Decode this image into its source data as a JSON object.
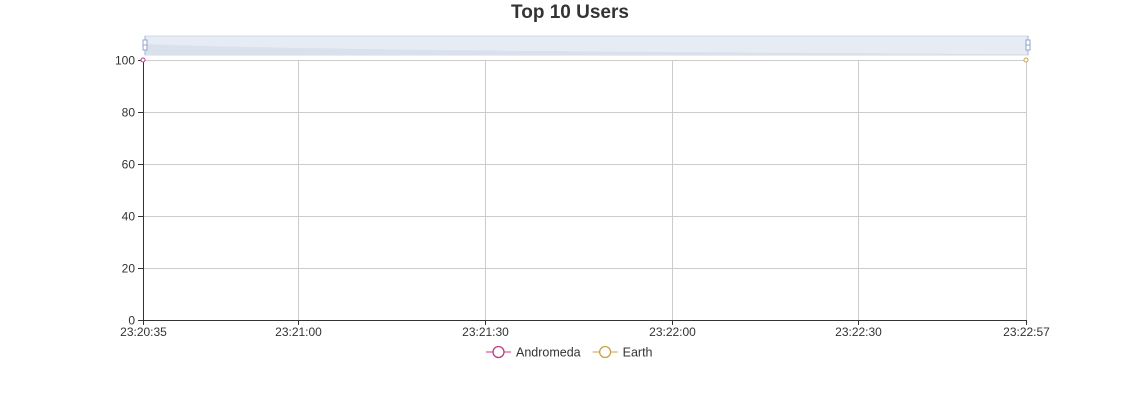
{
  "chart_data": {
    "type": "line",
    "title": "Top 10 Users",
    "xlabel": "",
    "ylabel": "",
    "x_ticks": [
      "23:20:35",
      "23:21:00",
      "23:21:30",
      "23:22:00",
      "23:22:30",
      "23:22:57"
    ],
    "xlim": [
      "23:20:35",
      "23:22:57"
    ],
    "y_ticks": [
      0,
      20,
      40,
      60,
      80,
      100
    ],
    "ylim": [
      0,
      100
    ],
    "grid": true,
    "legend_position": "bottom",
    "data_zoom_slider": true,
    "series": [
      {
        "name": "Andromeda",
        "color": "#c23a87",
        "points": [
          {
            "x": "23:20:35",
            "y": 100
          }
        ]
      },
      {
        "name": "Earth",
        "color": "#c9a24a",
        "points": [
          {
            "x": "23:22:57",
            "y": 100
          }
        ]
      }
    ]
  }
}
